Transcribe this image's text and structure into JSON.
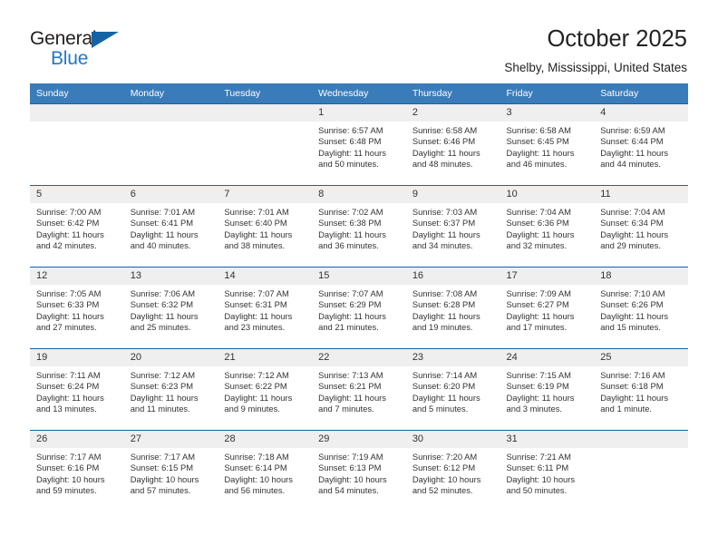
{
  "brand": {
    "name_part1": "General",
    "name_part2": "Blue",
    "triangle_color": "#1464a5",
    "blue_color": "#2277c8"
  },
  "header": {
    "title": "October 2025",
    "subtitle": "Shelby, Mississippi, United States"
  },
  "theme": {
    "header_bg": "#3a7cb9",
    "row_border": "#1464a5",
    "daynum_bg": "#efefef",
    "text": "#333333"
  },
  "weekday_headers": [
    "Sunday",
    "Monday",
    "Tuesday",
    "Wednesday",
    "Thursday",
    "Friday",
    "Saturday"
  ],
  "weeks": [
    [
      {
        "day": "",
        "sunrise": "",
        "sunset": "",
        "daylight_line1": "",
        "daylight_line2": ""
      },
      {
        "day": "",
        "sunrise": "",
        "sunset": "",
        "daylight_line1": "",
        "daylight_line2": ""
      },
      {
        "day": "",
        "sunrise": "",
        "sunset": "",
        "daylight_line1": "",
        "daylight_line2": ""
      },
      {
        "day": "1",
        "sunrise": "Sunrise: 6:57 AM",
        "sunset": "Sunset: 6:48 PM",
        "daylight_line1": "Daylight: 11 hours",
        "daylight_line2": "and 50 minutes."
      },
      {
        "day": "2",
        "sunrise": "Sunrise: 6:58 AM",
        "sunset": "Sunset: 6:46 PM",
        "daylight_line1": "Daylight: 11 hours",
        "daylight_line2": "and 48 minutes."
      },
      {
        "day": "3",
        "sunrise": "Sunrise: 6:58 AM",
        "sunset": "Sunset: 6:45 PM",
        "daylight_line1": "Daylight: 11 hours",
        "daylight_line2": "and 46 minutes."
      },
      {
        "day": "4",
        "sunrise": "Sunrise: 6:59 AM",
        "sunset": "Sunset: 6:44 PM",
        "daylight_line1": "Daylight: 11 hours",
        "daylight_line2": "and 44 minutes."
      }
    ],
    [
      {
        "day": "5",
        "sunrise": "Sunrise: 7:00 AM",
        "sunset": "Sunset: 6:42 PM",
        "daylight_line1": "Daylight: 11 hours",
        "daylight_line2": "and 42 minutes."
      },
      {
        "day": "6",
        "sunrise": "Sunrise: 7:01 AM",
        "sunset": "Sunset: 6:41 PM",
        "daylight_line1": "Daylight: 11 hours",
        "daylight_line2": "and 40 minutes."
      },
      {
        "day": "7",
        "sunrise": "Sunrise: 7:01 AM",
        "sunset": "Sunset: 6:40 PM",
        "daylight_line1": "Daylight: 11 hours",
        "daylight_line2": "and 38 minutes."
      },
      {
        "day": "8",
        "sunrise": "Sunrise: 7:02 AM",
        "sunset": "Sunset: 6:38 PM",
        "daylight_line1": "Daylight: 11 hours",
        "daylight_line2": "and 36 minutes."
      },
      {
        "day": "9",
        "sunrise": "Sunrise: 7:03 AM",
        "sunset": "Sunset: 6:37 PM",
        "daylight_line1": "Daylight: 11 hours",
        "daylight_line2": "and 34 minutes."
      },
      {
        "day": "10",
        "sunrise": "Sunrise: 7:04 AM",
        "sunset": "Sunset: 6:36 PM",
        "daylight_line1": "Daylight: 11 hours",
        "daylight_line2": "and 32 minutes."
      },
      {
        "day": "11",
        "sunrise": "Sunrise: 7:04 AM",
        "sunset": "Sunset: 6:34 PM",
        "daylight_line1": "Daylight: 11 hours",
        "daylight_line2": "and 29 minutes."
      }
    ],
    [
      {
        "day": "12",
        "sunrise": "Sunrise: 7:05 AM",
        "sunset": "Sunset: 6:33 PM",
        "daylight_line1": "Daylight: 11 hours",
        "daylight_line2": "and 27 minutes."
      },
      {
        "day": "13",
        "sunrise": "Sunrise: 7:06 AM",
        "sunset": "Sunset: 6:32 PM",
        "daylight_line1": "Daylight: 11 hours",
        "daylight_line2": "and 25 minutes."
      },
      {
        "day": "14",
        "sunrise": "Sunrise: 7:07 AM",
        "sunset": "Sunset: 6:31 PM",
        "daylight_line1": "Daylight: 11 hours",
        "daylight_line2": "and 23 minutes."
      },
      {
        "day": "15",
        "sunrise": "Sunrise: 7:07 AM",
        "sunset": "Sunset: 6:29 PM",
        "daylight_line1": "Daylight: 11 hours",
        "daylight_line2": "and 21 minutes."
      },
      {
        "day": "16",
        "sunrise": "Sunrise: 7:08 AM",
        "sunset": "Sunset: 6:28 PM",
        "daylight_line1": "Daylight: 11 hours",
        "daylight_line2": "and 19 minutes."
      },
      {
        "day": "17",
        "sunrise": "Sunrise: 7:09 AM",
        "sunset": "Sunset: 6:27 PM",
        "daylight_line1": "Daylight: 11 hours",
        "daylight_line2": "and 17 minutes."
      },
      {
        "day": "18",
        "sunrise": "Sunrise: 7:10 AM",
        "sunset": "Sunset: 6:26 PM",
        "daylight_line1": "Daylight: 11 hours",
        "daylight_line2": "and 15 minutes."
      }
    ],
    [
      {
        "day": "19",
        "sunrise": "Sunrise: 7:11 AM",
        "sunset": "Sunset: 6:24 PM",
        "daylight_line1": "Daylight: 11 hours",
        "daylight_line2": "and 13 minutes."
      },
      {
        "day": "20",
        "sunrise": "Sunrise: 7:12 AM",
        "sunset": "Sunset: 6:23 PM",
        "daylight_line1": "Daylight: 11 hours",
        "daylight_line2": "and 11 minutes."
      },
      {
        "day": "21",
        "sunrise": "Sunrise: 7:12 AM",
        "sunset": "Sunset: 6:22 PM",
        "daylight_line1": "Daylight: 11 hours",
        "daylight_line2": "and 9 minutes."
      },
      {
        "day": "22",
        "sunrise": "Sunrise: 7:13 AM",
        "sunset": "Sunset: 6:21 PM",
        "daylight_line1": "Daylight: 11 hours",
        "daylight_line2": "and 7 minutes."
      },
      {
        "day": "23",
        "sunrise": "Sunrise: 7:14 AM",
        "sunset": "Sunset: 6:20 PM",
        "daylight_line1": "Daylight: 11 hours",
        "daylight_line2": "and 5 minutes."
      },
      {
        "day": "24",
        "sunrise": "Sunrise: 7:15 AM",
        "sunset": "Sunset: 6:19 PM",
        "daylight_line1": "Daylight: 11 hours",
        "daylight_line2": "and 3 minutes."
      },
      {
        "day": "25",
        "sunrise": "Sunrise: 7:16 AM",
        "sunset": "Sunset: 6:18 PM",
        "daylight_line1": "Daylight: 11 hours",
        "daylight_line2": "and 1 minute."
      }
    ],
    [
      {
        "day": "26",
        "sunrise": "Sunrise: 7:17 AM",
        "sunset": "Sunset: 6:16 PM",
        "daylight_line1": "Daylight: 10 hours",
        "daylight_line2": "and 59 minutes."
      },
      {
        "day": "27",
        "sunrise": "Sunrise: 7:17 AM",
        "sunset": "Sunset: 6:15 PM",
        "daylight_line1": "Daylight: 10 hours",
        "daylight_line2": "and 57 minutes."
      },
      {
        "day": "28",
        "sunrise": "Sunrise: 7:18 AM",
        "sunset": "Sunset: 6:14 PM",
        "daylight_line1": "Daylight: 10 hours",
        "daylight_line2": "and 56 minutes."
      },
      {
        "day": "29",
        "sunrise": "Sunrise: 7:19 AM",
        "sunset": "Sunset: 6:13 PM",
        "daylight_line1": "Daylight: 10 hours",
        "daylight_line2": "and 54 minutes."
      },
      {
        "day": "30",
        "sunrise": "Sunrise: 7:20 AM",
        "sunset": "Sunset: 6:12 PM",
        "daylight_line1": "Daylight: 10 hours",
        "daylight_line2": "and 52 minutes."
      },
      {
        "day": "31",
        "sunrise": "Sunrise: 7:21 AM",
        "sunset": "Sunset: 6:11 PM",
        "daylight_line1": "Daylight: 10 hours",
        "daylight_line2": "and 50 minutes."
      },
      {
        "day": "",
        "sunrise": "",
        "sunset": "",
        "daylight_line1": "",
        "daylight_line2": ""
      }
    ]
  ]
}
